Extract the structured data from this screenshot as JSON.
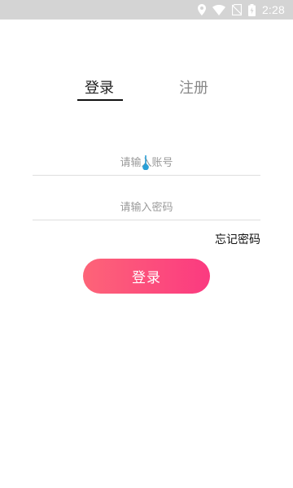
{
  "status_bar": {
    "time": "2:28",
    "icons": [
      "location-icon",
      "wifi-icon",
      "no-sim-icon",
      "battery-charging-icon"
    ]
  },
  "tabs": [
    {
      "label": "登录",
      "active": true
    },
    {
      "label": "注册",
      "active": false
    }
  ],
  "form": {
    "account_placeholder": "请输入账号",
    "account_value": "",
    "password_placeholder": "请输入密码",
    "password_value": ""
  },
  "forgot_password": "忘记密码",
  "login_button": "登录",
  "colors": {
    "status_bar": "#d4d4d4",
    "button_gradient_start": "#fd6478",
    "button_gradient_end": "#fb3a80",
    "cursor_handle": "#2a9fd6"
  }
}
